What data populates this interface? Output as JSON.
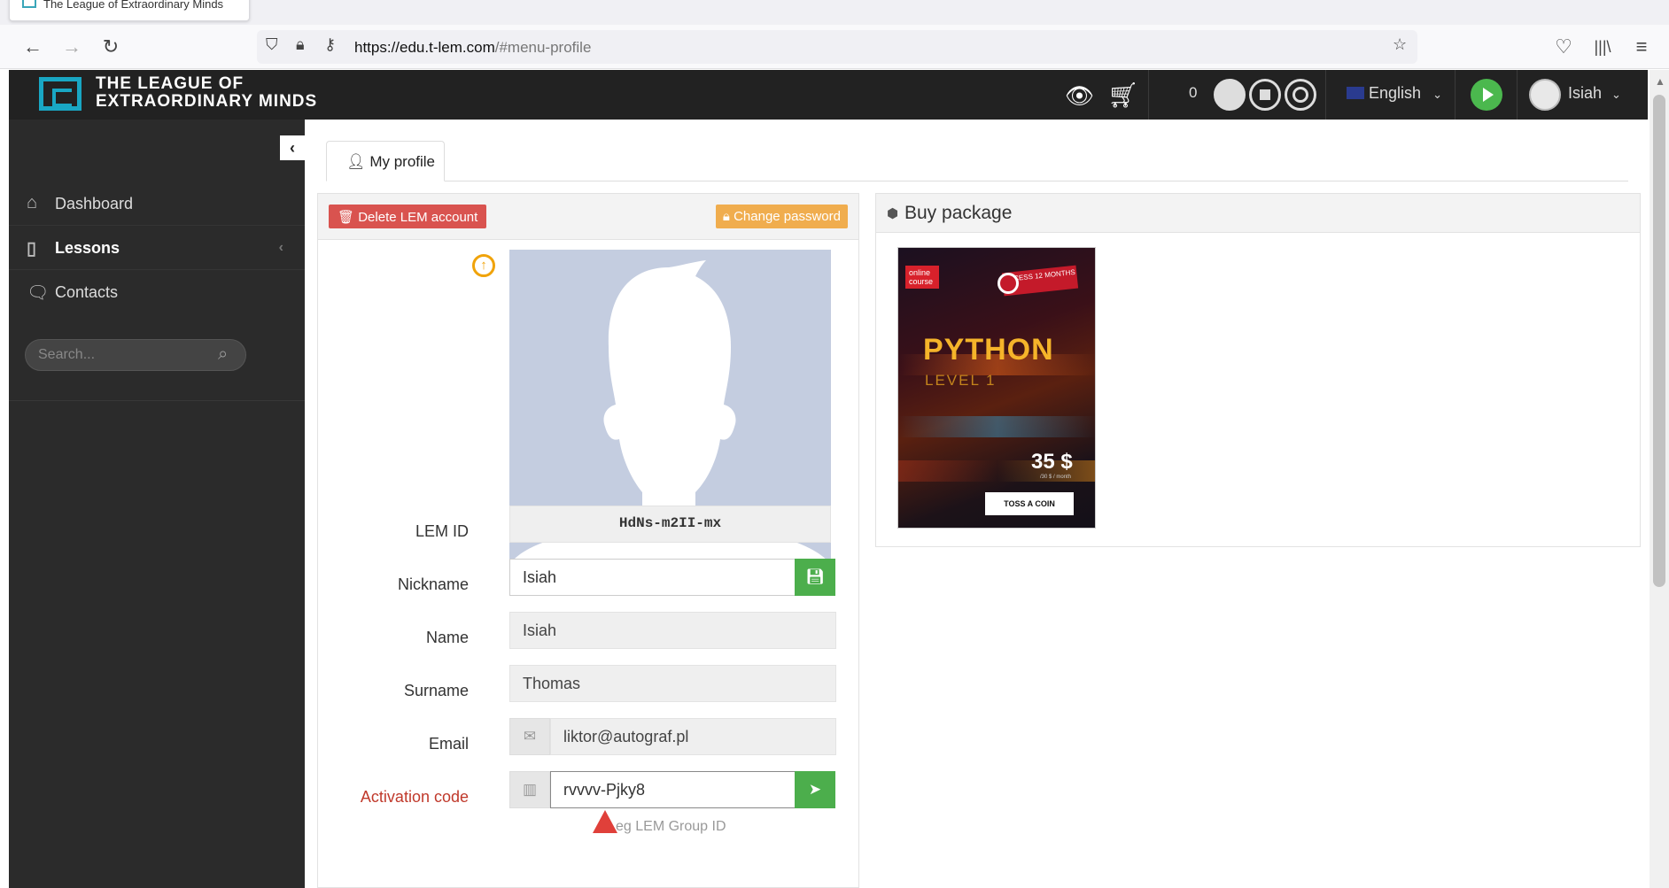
{
  "browser": {
    "tab_title": "The League of Extraordinary Minds",
    "url_host": "https://edu.t-lem.com",
    "url_path": "/#menu-profile"
  },
  "header": {
    "logo_line1": "THE LEAGUE OF",
    "logo_line2": "EXTRAORDINARY MINDS",
    "coin_count": "0",
    "language": "English",
    "user_name": "Isiah"
  },
  "sidebar": {
    "items": [
      {
        "label": "Dashboard",
        "icon": "home-icon"
      },
      {
        "label": "Lessons",
        "icon": "book-icon"
      },
      {
        "label": "Contacts",
        "icon": "chat-icon"
      }
    ],
    "search_placeholder": "Search..."
  },
  "main": {
    "tab_label": "My profile",
    "delete_button": "Delete LEM account",
    "change_password_button": "Change password",
    "form": {
      "lem_id_label": "LEM ID",
      "lem_id_value": "HdNs-m2II-mx",
      "nickname_label": "Nickname",
      "nickname_value": "Isiah",
      "name_label": "Name",
      "name_value": "Isiah",
      "surname_label": "Surname",
      "surname_value": "Thomas",
      "email_label": "Email",
      "email_value": "liktor@autograf.pl",
      "activation_label": "Activation code",
      "activation_value": "rvvvv-Pjky8",
      "activation_hint": "eg LEM Group ID"
    },
    "buy_package": {
      "title": "Buy package",
      "poster": {
        "badge": "online course",
        "access": "ACCESS 12 MONTHS",
        "course": "PYTHON",
        "level": "LEVEL 1",
        "price": "35 $",
        "per": "/30 $ / month",
        "button": "TOSS A COIN"
      }
    }
  },
  "colors": {
    "brand": "#19a7c4",
    "danger": "#d9534f",
    "warning": "#f0ad4e",
    "success": "#4cae4c"
  }
}
